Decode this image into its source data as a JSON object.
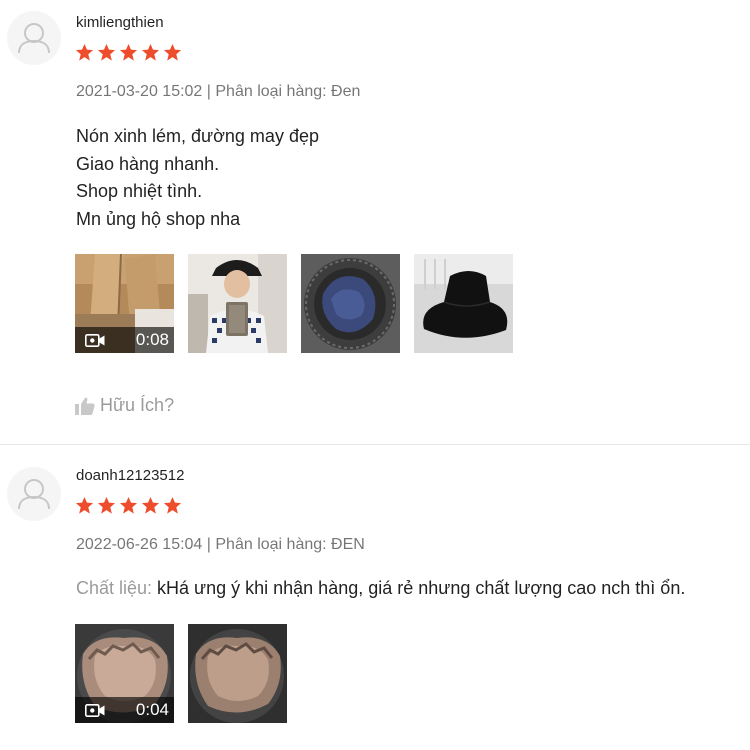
{
  "colors": {
    "star": "#ee4d2d",
    "muted": "#9e9e9e",
    "text": "#222222"
  },
  "reviews": [
    {
      "username": "kimliengthien",
      "rating": 5,
      "meta": "2021-03-20 15:02 | Phân loại hàng: Đen",
      "content_lines": [
        "Nón xinh lém, đường may đẹp",
        "Giao hàng nhanh.",
        "Shop nhiệt tình.",
        "Mn ủng hộ shop nha"
      ],
      "media": [
        {
          "kind": "video",
          "duration": "0:08",
          "icon": "video-camera-icon"
        },
        {
          "kind": "image"
        },
        {
          "kind": "image"
        },
        {
          "kind": "image"
        }
      ],
      "helpful_label": "Hữu Ích?"
    },
    {
      "username": "doanh12123512",
      "rating": 5,
      "meta": "2022-06-26 15:04 | Phân loại hàng: ĐEN",
      "attr_label": "Chất liệu:",
      "attr_value": " kHá ưng ý khi nhận hàng, giá rẻ nhưng chất lượng cao nch thì ổn.",
      "media": [
        {
          "kind": "video",
          "duration": "0:04",
          "icon": "video-camera-icon"
        },
        {
          "kind": "image"
        }
      ]
    }
  ]
}
